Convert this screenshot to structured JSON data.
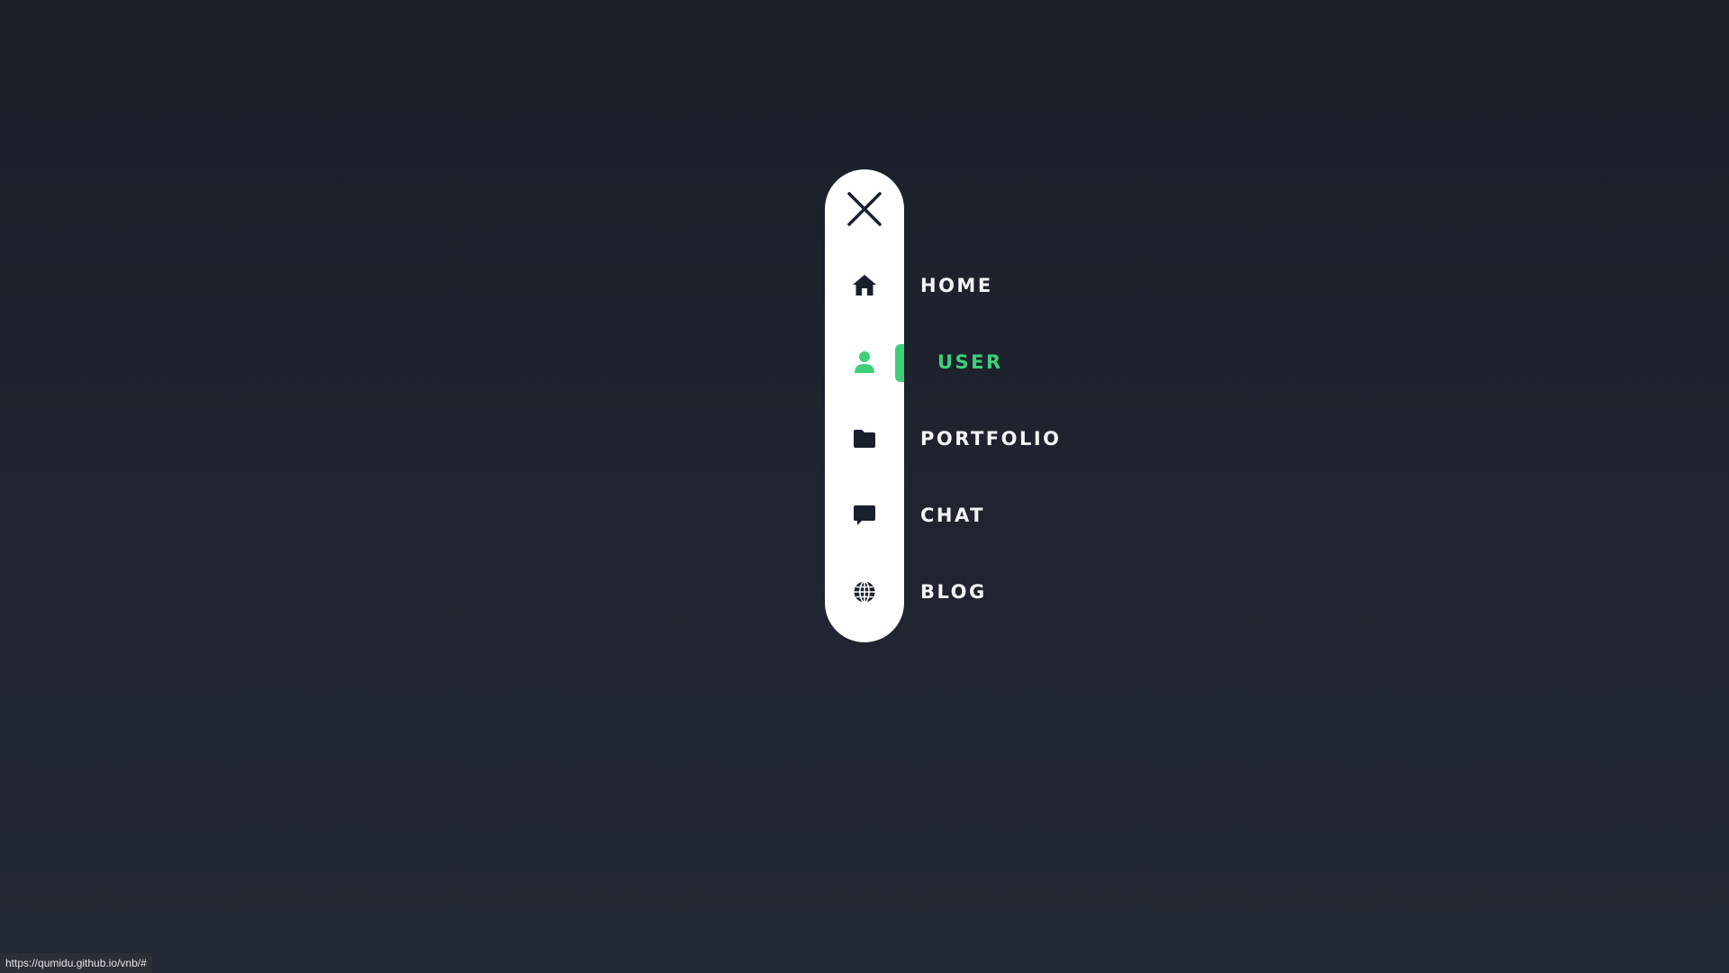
{
  "nav": {
    "close_icon": "close-icon",
    "items": [
      {
        "label": "HOME",
        "icon": "home-icon",
        "active": false
      },
      {
        "label": "USER",
        "icon": "user-icon",
        "active": true
      },
      {
        "label": "PORTFOLIO",
        "icon": "folder-icon",
        "active": false
      },
      {
        "label": "CHAT",
        "icon": "chat-icon",
        "active": false
      },
      {
        "label": "BLOG",
        "icon": "globe-icon",
        "active": false
      }
    ]
  },
  "status_bar": {
    "url": "https://qumidu.github.io/vnb/#"
  },
  "colors": {
    "background": "#1f2430",
    "pill": "#ffffff",
    "accent": "#3ecf7a",
    "icon": "#1a1f2e",
    "label": "#f3f4f6"
  }
}
